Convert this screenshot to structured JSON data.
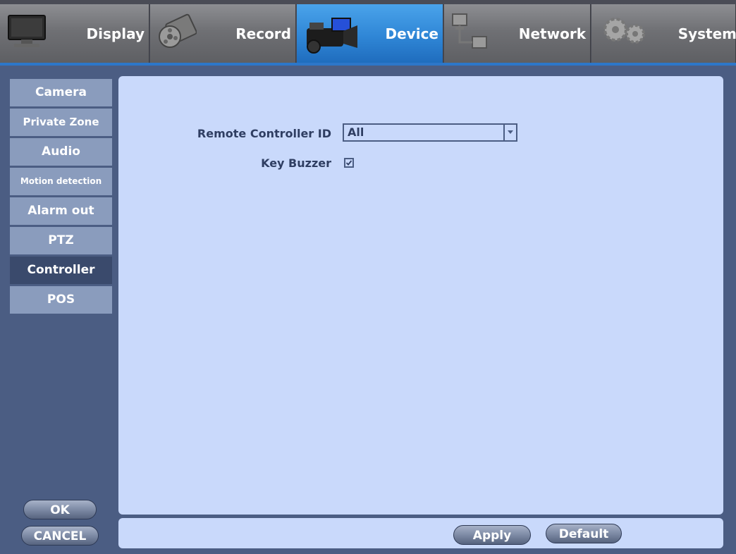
{
  "tabs": [
    {
      "label": "Display",
      "icon": "monitor-icon"
    },
    {
      "label": "Record",
      "icon": "film-reel-icon"
    },
    {
      "label": "Device",
      "icon": "camcorder-icon",
      "active": true
    },
    {
      "label": "Network",
      "icon": "network-icon"
    },
    {
      "label": "System",
      "icon": "gears-icon"
    }
  ],
  "sidebar": {
    "items": [
      {
        "label": "Camera"
      },
      {
        "label": "Private Zone"
      },
      {
        "label": "Audio"
      },
      {
        "label": "Motion detection"
      },
      {
        "label": "Alarm out"
      },
      {
        "label": "PTZ"
      },
      {
        "label": "Controller",
        "active": true
      },
      {
        "label": "POS"
      }
    ],
    "ok_label": "OK",
    "cancel_label": "CANCEL"
  },
  "form": {
    "remote_controller_id_label": "Remote Controller ID",
    "remote_controller_id_value": "All",
    "key_buzzer_label": "Key Buzzer",
    "key_buzzer_checked": true
  },
  "footer": {
    "apply_label": "Apply",
    "default_label": "Default"
  },
  "colors": {
    "accent": "#2f86d6",
    "panel": "#c9d9fb",
    "sidebar_item": "#8a9cbd",
    "sidebar_active": "#3a4a6c",
    "frame": "#4b5d83"
  }
}
